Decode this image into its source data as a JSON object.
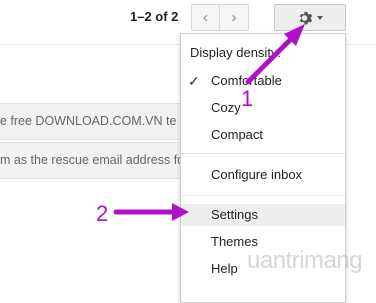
{
  "toolbar": {
    "pager_text": "1–2 of 2",
    "prev_icon": "chevron-left-icon",
    "next_icon": "chevron-right-icon",
    "settings_icon": "gear-icon"
  },
  "messages": [
    {
      "snippet": "e free DOWNLOAD.COM.VN te"
    },
    {
      "snippet": "m as the rescue email address fo"
    }
  ],
  "menu": {
    "header": "Display density:",
    "density_options": [
      {
        "label": "Comfortable",
        "checked": true
      },
      {
        "label": "Cozy",
        "checked": false
      },
      {
        "label": "Compact",
        "checked": false
      }
    ],
    "configure_inbox": "Configure inbox",
    "settings": "Settings",
    "themes": "Themes",
    "help": "Help"
  },
  "annotations": {
    "step1": "1",
    "step2": "2",
    "color": "#b010c8"
  },
  "watermark": "uantrimang"
}
